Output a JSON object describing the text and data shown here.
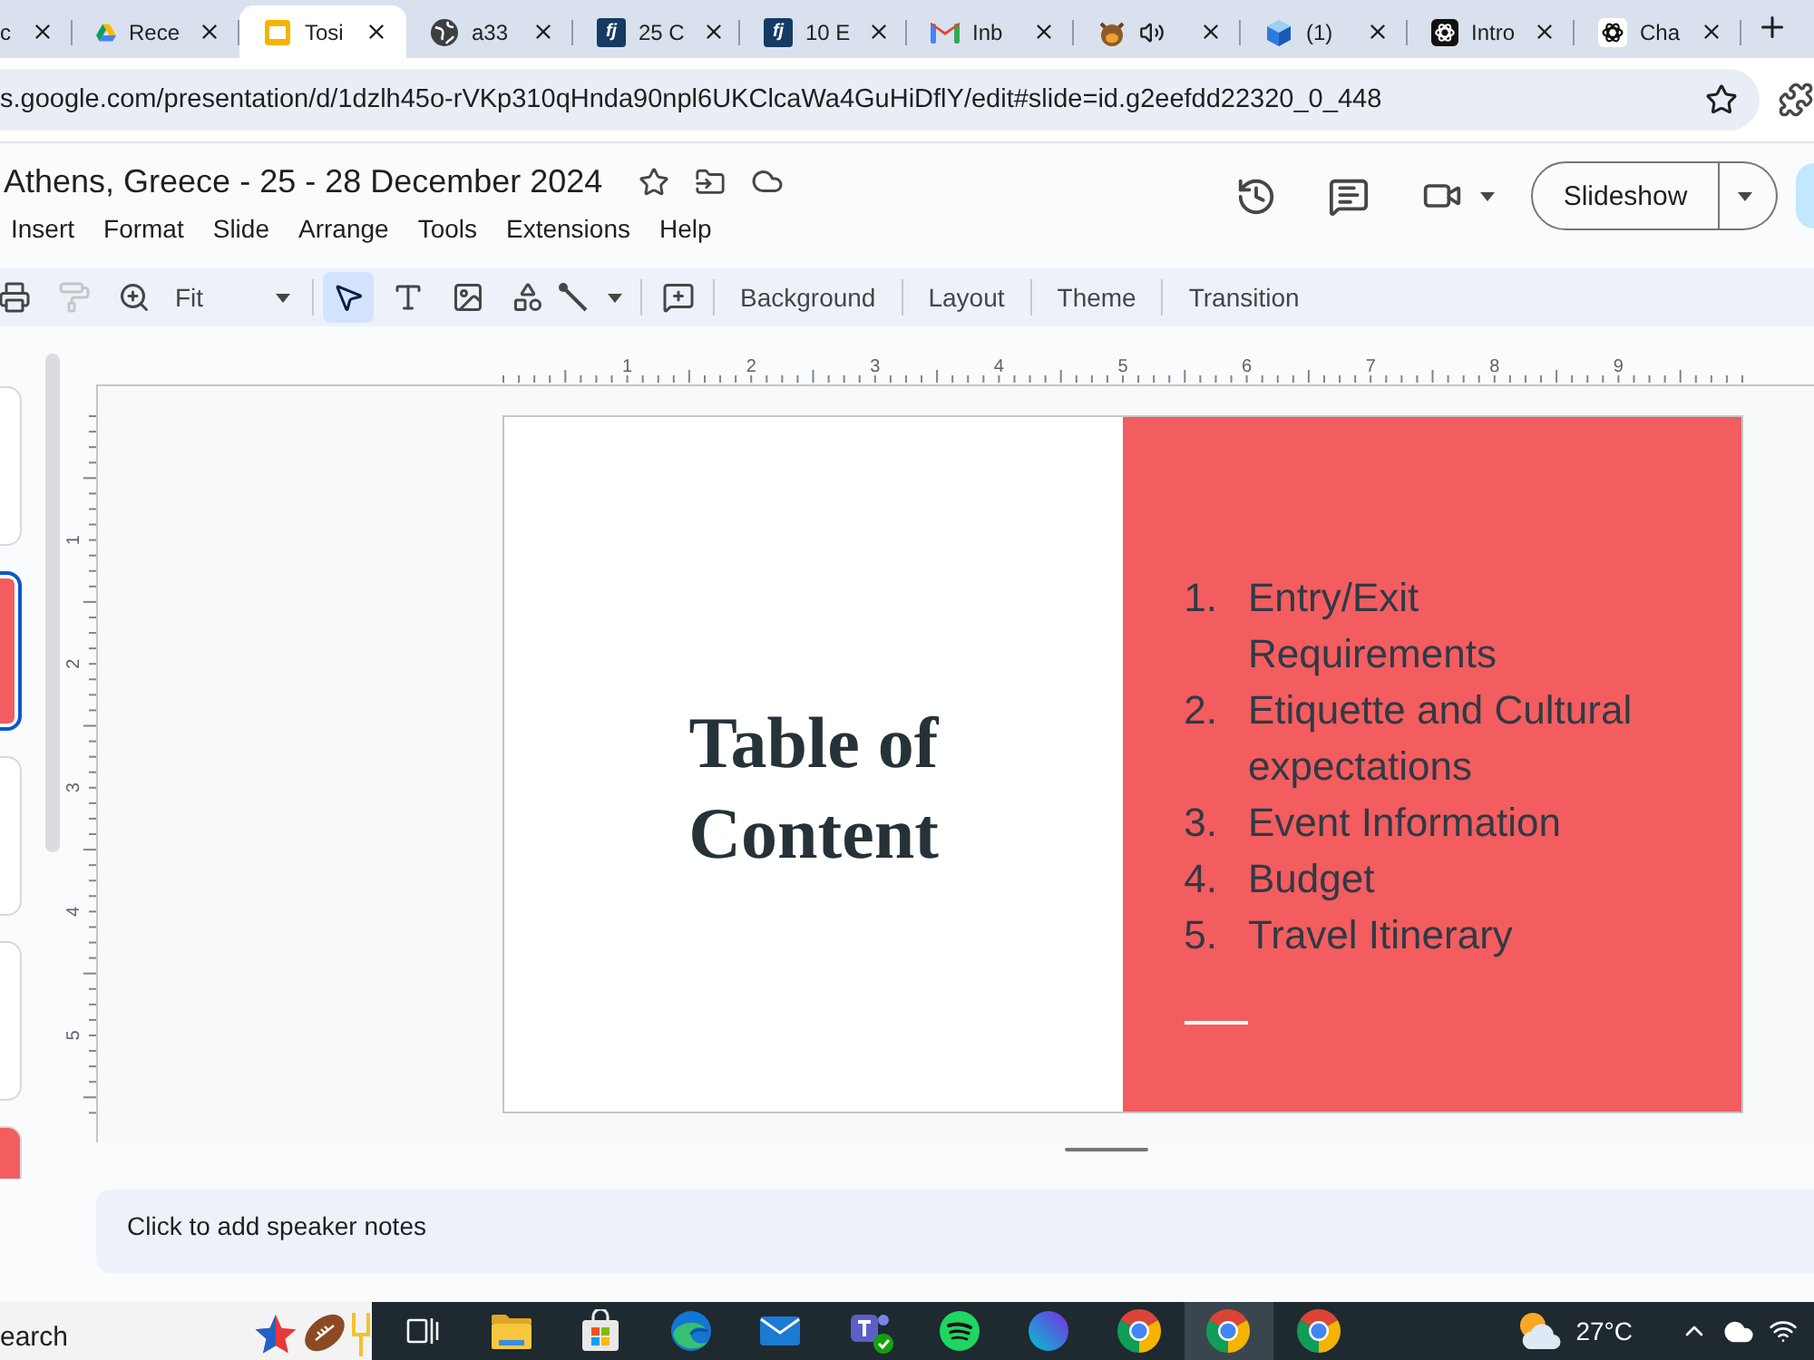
{
  "browser": {
    "tabs": [
      {
        "kind": "none",
        "label": "c",
        "selected": false,
        "audio": false
      },
      {
        "kind": "drive",
        "label": "Rece",
        "selected": false,
        "audio": false
      },
      {
        "kind": "slides",
        "label": "Tosi",
        "selected": true,
        "audio": false
      },
      {
        "kind": "globe",
        "label": "a33",
        "selected": false,
        "audio": false
      },
      {
        "kind": "fj",
        "logo": "fj",
        "label": "25 C",
        "selected": false,
        "audio": false
      },
      {
        "kind": "fj",
        "logo": "fj",
        "label": "10 E",
        "selected": false,
        "audio": false
      },
      {
        "kind": "gmail",
        "label": "Inb",
        "selected": false,
        "audio": false
      },
      {
        "kind": "animal",
        "selected": false,
        "audio": true
      },
      {
        "kind": "cube",
        "label": "(1)",
        "selected": false,
        "audio": false
      },
      {
        "kind": "knot-dark",
        "label": "Intro",
        "selected": false,
        "audio": false
      },
      {
        "kind": "knot-light",
        "label": "Cha",
        "selected": false,
        "audio": false
      }
    ],
    "address": {
      "url": "s.google.com/presentation/d/1dzlh45o-rVKp310qHnda90npl6UKClcaWa4GuHiDflY/edit#slide=id.g2eefdd22320_0_448"
    }
  },
  "doc": {
    "title": "Athens, Greece - 25 - 28 December 2024",
    "starred": false,
    "menu": [
      "Insert",
      "Format",
      "Slide",
      "Arrange",
      "Tools",
      "Extensions",
      "Help"
    ],
    "present": {
      "label": "Slideshow"
    }
  },
  "toolbar": {
    "tools": [
      {
        "kind": "print",
        "disabled": false
      },
      {
        "kind": "paint-format",
        "disabled": true
      },
      {
        "kind": "zoom",
        "disabled": false
      }
    ],
    "zoom": {
      "value": "Fit"
    },
    "insert_tools": [
      {
        "kind": "select",
        "selected": true
      },
      {
        "kind": "text-box",
        "selected": false
      },
      {
        "kind": "image",
        "selected": false
      },
      {
        "kind": "shape",
        "selected": false
      },
      {
        "kind": "line",
        "selected": false
      }
    ],
    "actions": [
      "Background",
      "Layout",
      "Theme",
      "Transition"
    ]
  },
  "filmstrip": {
    "slides": [
      {
        "color": "#ffffff",
        "selected": false
      },
      {
        "color": "#f35d5f",
        "selected": true
      },
      {
        "color": "#ffffff",
        "selected": false
      },
      {
        "color": "#ffffff",
        "selected": false
      },
      {
        "color": "#f35d5f",
        "selected": false
      }
    ]
  },
  "rulers": {
    "horizontal": [
      "1",
      "2",
      "3",
      "4",
      "5",
      "6",
      "7",
      "8",
      "9"
    ],
    "vertical": [
      "1",
      "2",
      "3",
      "4",
      "5"
    ]
  },
  "slide": {
    "title": "Table of Content",
    "items": [
      {
        "marker": "1.",
        "text": "Entry/Exit Requirements"
      },
      {
        "marker": "2.",
        "text": "Etiquette and Cultural expectations"
      },
      {
        "marker": "3.",
        "text": "Event Information"
      },
      {
        "marker": "4.",
        "text": "Budget"
      },
      {
        "marker": "5.",
        "text": "Travel Itinerary"
      }
    ]
  },
  "notes": {
    "placeholder": "Click to add speaker notes"
  },
  "taskbar": {
    "search": {
      "placeholder": "earch"
    },
    "apps": [
      {
        "kind": "task-view",
        "selected": false
      },
      {
        "kind": "file-explorer",
        "selected": false
      },
      {
        "kind": "store",
        "selected": false
      },
      {
        "kind": "edge",
        "selected": false
      },
      {
        "kind": "mail",
        "selected": false
      },
      {
        "kind": "teams",
        "selected": false
      },
      {
        "kind": "spotify",
        "selected": false
      },
      {
        "kind": "canva",
        "selected": false
      },
      {
        "kind": "chrome",
        "selected": false
      },
      {
        "kind": "chrome",
        "selected": true
      },
      {
        "kind": "chrome",
        "selected": false
      }
    ],
    "weather": {
      "temperature": "27°C"
    }
  }
}
